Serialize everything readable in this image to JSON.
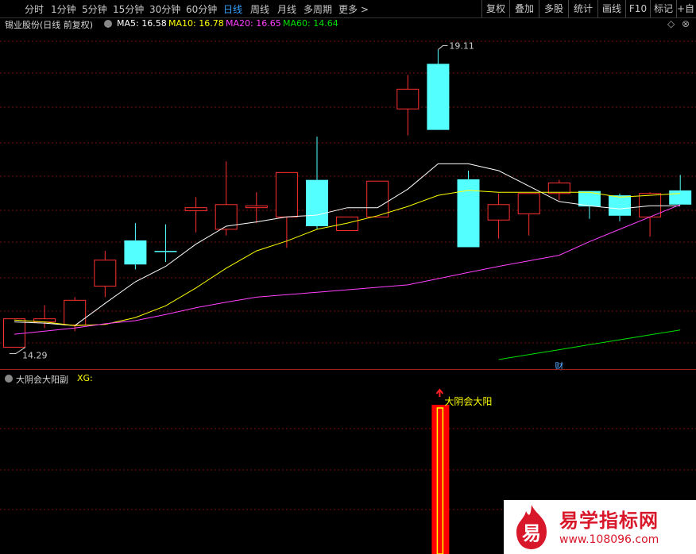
{
  "toolbar": {
    "periods": [
      "分时",
      "1分钟",
      "5分钟",
      "15分钟",
      "30分钟",
      "60分钟",
      "日线",
      "周线",
      "月线",
      "多周期",
      "更多 >"
    ],
    "active_period": "日线",
    "right_buttons": [
      "复权",
      "叠加",
      "多股",
      "统计",
      "画线",
      "F10",
      "标记",
      "+自选"
    ]
  },
  "main_panel": {
    "stock_title": "锡业股份(日线 前复权)",
    "ma_labels": [
      {
        "text": "MA5: 16.58",
        "color": "#ffffff"
      },
      {
        "text": "MA10: 16.78",
        "color": "#ffff00"
      },
      {
        "text": "MA20: 16.65",
        "color": "#ff40ff"
      },
      {
        "text": "MA60: 14.64",
        "color": "#00e000"
      }
    ],
    "high_label": "19.11",
    "low_label": "14.29",
    "marker_label": "财"
  },
  "sub_panel": {
    "indicator_title": "大阴会大阳副",
    "indicator_var": "XG:",
    "signal_label": "大阴会大阳"
  },
  "watermark": {
    "logo_char": "易",
    "name": "易学指标网",
    "url": "www.108096.com"
  },
  "colors": {
    "up": "#ff3030",
    "down": "#54ffff",
    "grid": "#7a1010",
    "signal_fill": "#ff0000",
    "signal_inner": "#ffff00"
  },
  "chart_data": {
    "type": "candlestick",
    "candles": [
      {
        "o": 14.29,
        "c": 14.75,
        "h": 14.75,
        "l": 14.29,
        "dir": "up"
      },
      {
        "o": 14.7,
        "c": 14.75,
        "h": 14.97,
        "l": 14.6,
        "dir": "up"
      },
      {
        "o": 14.65,
        "c": 15.05,
        "h": 15.1,
        "l": 14.55,
        "dir": "up"
      },
      {
        "o": 15.28,
        "c": 15.7,
        "h": 15.85,
        "l": 15.1,
        "dir": "up"
      },
      {
        "o": 16.02,
        "c": 15.63,
        "h": 16.3,
        "l": 15.55,
        "dir": "down"
      },
      {
        "o": 15.85,
        "c": 15.85,
        "h": 16.28,
        "l": 15.67,
        "dir": "down"
      },
      {
        "o": 16.5,
        "c": 16.55,
        "h": 16.72,
        "l": 16.15,
        "dir": "up"
      },
      {
        "o": 16.2,
        "c": 16.6,
        "h": 17.3,
        "l": 16.1,
        "dir": "up"
      },
      {
        "o": 16.55,
        "c": 16.58,
        "h": 16.8,
        "l": 16.3,
        "dir": "up"
      },
      {
        "o": 16.4,
        "c": 17.12,
        "h": 17.12,
        "l": 15.9,
        "dir": "up"
      },
      {
        "o": 17.0,
        "c": 16.25,
        "h": 17.7,
        "l": 16.2,
        "dir": "down"
      },
      {
        "o": 16.18,
        "c": 16.4,
        "h": 16.4,
        "l": 16.18,
        "dir": "up"
      },
      {
        "o": 16.4,
        "c": 16.98,
        "h": 16.98,
        "l": 16.4,
        "dir": "up"
      },
      {
        "o": 18.15,
        "c": 18.47,
        "h": 18.7,
        "l": 17.72,
        "dir": "up"
      },
      {
        "o": 18.88,
        "c": 17.81,
        "h": 19.11,
        "l": 17.81,
        "dir": "down"
      },
      {
        "o": 17.01,
        "c": 15.91,
        "h": 17.15,
        "l": 15.91,
        "dir": "down"
      },
      {
        "o": 16.35,
        "c": 16.6,
        "h": 16.78,
        "l": 16.05,
        "dir": "up"
      },
      {
        "o": 16.45,
        "c": 16.78,
        "h": 16.78,
        "l": 16.1,
        "dir": "up"
      },
      {
        "o": 16.78,
        "c": 16.95,
        "h": 17.0,
        "l": 16.67,
        "dir": "up"
      },
      {
        "o": 16.82,
        "c": 16.57,
        "h": 16.82,
        "l": 16.37,
        "dir": "down"
      },
      {
        "o": 16.75,
        "c": 16.42,
        "h": 16.78,
        "l": 16.33,
        "dir": "down"
      },
      {
        "o": 16.4,
        "c": 16.78,
        "h": 16.8,
        "l": 16.08,
        "dir": "up"
      },
      {
        "o": 16.83,
        "c": 16.6,
        "h": 17.08,
        "l": 16.6,
        "dir": "down"
      }
    ],
    "ma5": [
      14.7,
      14.68,
      14.64,
      15.0,
      15.35,
      15.6,
      15.96,
      16.25,
      16.32,
      16.4,
      16.43,
      16.55,
      16.55,
      16.85,
      17.26,
      17.26,
      17.15,
      16.9,
      16.65,
      16.58,
      16.53,
      16.58,
      16.58
    ],
    "ma10": [
      14.73,
      14.7,
      14.64,
      14.66,
      14.77,
      14.96,
      15.25,
      15.57,
      15.85,
      16.01,
      16.2,
      16.3,
      16.42,
      16.57,
      16.75,
      16.83,
      16.8,
      16.8,
      16.8,
      16.8,
      16.72,
      16.75,
      16.78
    ],
    "ma20": [
      14.5,
      14.55,
      14.6,
      14.67,
      14.72,
      14.82,
      14.93,
      15.02,
      15.1,
      15.14,
      15.18,
      15.22,
      15.26,
      15.3,
      15.4,
      15.5,
      15.6,
      15.69,
      15.78,
      16.0,
      16.2,
      16.4,
      16.6
    ],
    "ma60": [
      null,
      null,
      null,
      null,
      null,
      null,
      null,
      null,
      null,
      null,
      null,
      null,
      null,
      null,
      null,
      null,
      14.09,
      14.17,
      14.25,
      14.33,
      14.41,
      14.49,
      14.57
    ],
    "signal_index": 14,
    "ylim": [
      14.0,
      19.4
    ]
  }
}
